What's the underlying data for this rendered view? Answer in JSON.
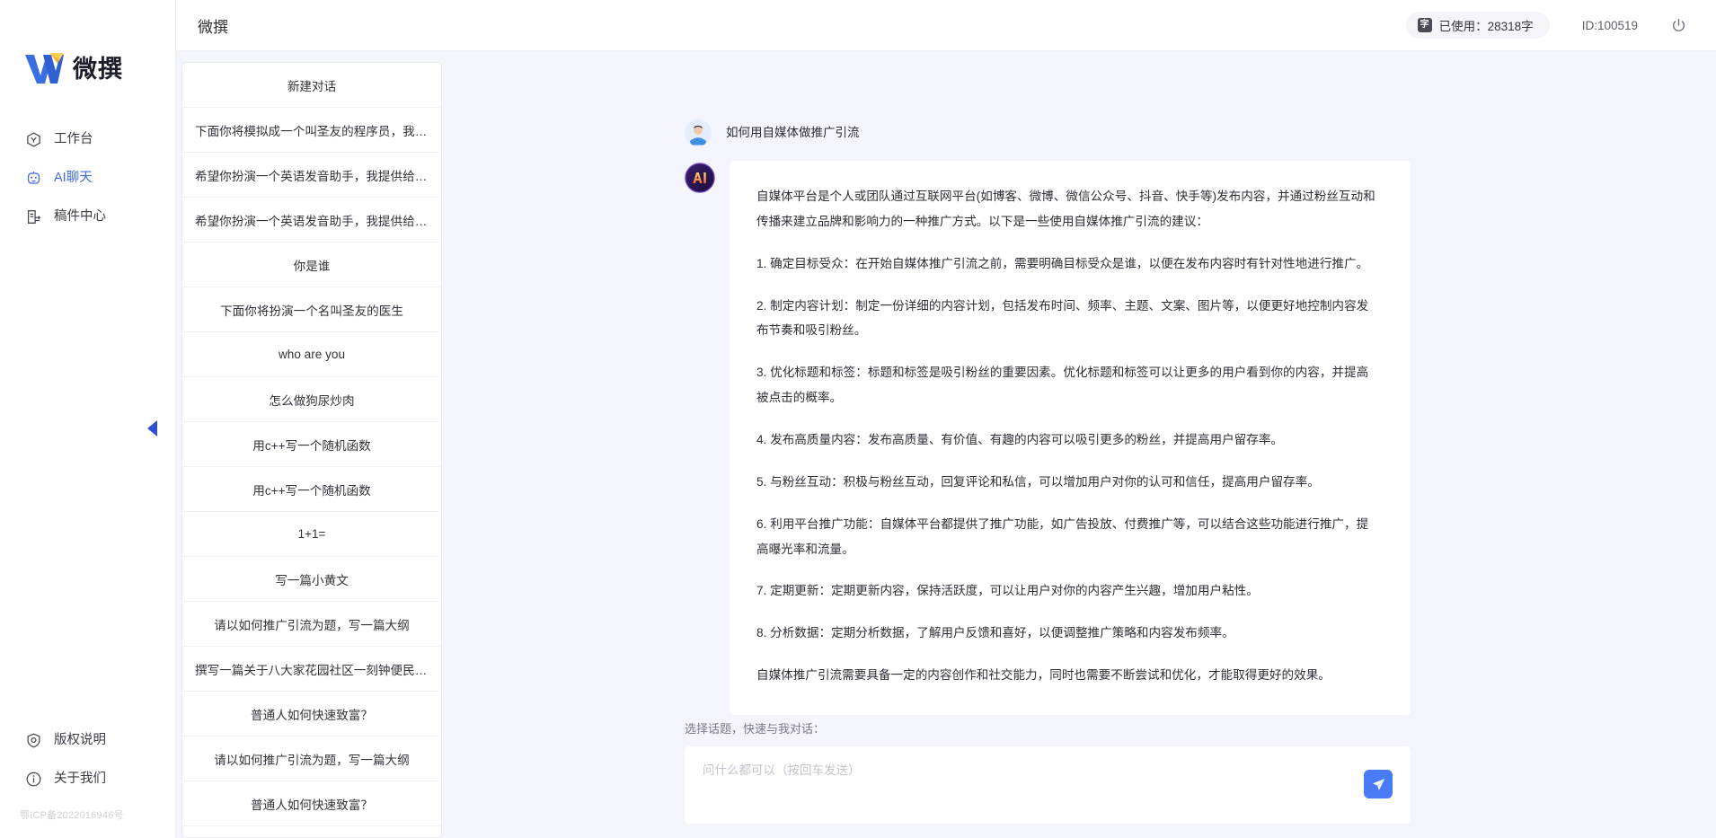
{
  "brand": {
    "name": "微撰",
    "logo_icon": "w-logo-icon"
  },
  "sidebar": {
    "items": [
      {
        "label": "工作台",
        "icon": "workbench-icon",
        "active": false
      },
      {
        "label": "AI聊天",
        "icon": "robot-icon",
        "active": true
      },
      {
        "label": "稿件中心",
        "icon": "document-edit-icon",
        "active": false
      }
    ],
    "bottom_items": [
      {
        "label": "版权说明",
        "icon": "shield-icon"
      },
      {
        "label": "关于我们",
        "icon": "info-icon"
      }
    ],
    "copyright": "鄂ICP备2022016946号",
    "collapse_icon": "chevron-left-icon"
  },
  "header": {
    "title": "微撰",
    "usage": {
      "badge": "字",
      "label": "已使用：28318字",
      "icon": "text-count-icon"
    },
    "user_id": "ID:100519",
    "power_icon": "power-icon"
  },
  "conversations": {
    "new_chat_label": "新建对话",
    "items": [
      "下面你将模拟成一个叫圣友的程序员，我说...",
      "希望你扮演一个英语发音助手，我提供给你...",
      "希望你扮演一个英语发音助手，我提供给你...",
      "你是谁",
      "下面你将扮演一个名叫圣友的医生",
      "who are you",
      "怎么做狗尿炒肉",
      "用c++写一个随机函数",
      "用c++写一个随机函数",
      "1+1=",
      "写一篇小黄文",
      "请以如何推广引流为题，写一篇大纲",
      "撰写一篇关于八大家花园社区一刻钟便民生...",
      "普通人如何快速致富？",
      "请以如何推广引流为题，写一篇大纲",
      "普通人如何快速致富？"
    ]
  },
  "chat": {
    "user_avatar_icon": "user-avatar-icon",
    "ai_avatar_icon": "ai-avatar-icon",
    "user_message": "如何用自媒体做推广引流",
    "ai_paragraphs": [
      "自媒体平台是个人或团队通过互联网平台(如博客、微博、微信公众号、抖音、快手等)发布内容，并通过粉丝互动和传播来建立品牌和影响力的一种推广方式。以下是一些使用自媒体推广引流的建议：",
      "1. 确定目标受众：在开始自媒体推广引流之前，需要明确目标受众是谁，以便在发布内容时有针对性地进行推广。",
      "2. 制定内容计划：制定一份详细的内容计划，包括发布时间、频率、主题、文案、图片等，以便更好地控制内容发布节奏和吸引粉丝。",
      "3. 优化标题和标签：标题和标签是吸引粉丝的重要因素。优化标题和标签可以让更多的用户看到你的内容，并提高被点击的概率。",
      "4. 发布高质量内容：发布高质量、有价值、有趣的内容可以吸引更多的粉丝，并提高用户留存率。",
      "5. 与粉丝互动：积极与粉丝互动，回复评论和私信，可以增加用户对你的认可和信任，提高用户留存率。",
      "6. 利用平台推广功能：自媒体平台都提供了推广功能，如广告投放、付费推广等，可以结合这些功能进行推广，提高曝光率和流量。",
      "7. 定期更新：定期更新内容，保持活跃度，可以让用户对你的内容产生兴趣，增加用户粘性。",
      "8. 分析数据：定期分析数据，了解用户反馈和喜好，以便调整推广策略和内容发布频率。",
      "自媒体推广引流需要具备一定的内容创作和社交能力，同时也需要不断尝试和优化，才能取得更好的效果。"
    ]
  },
  "composer": {
    "hint": "选择话题，快速与我对话：",
    "placeholder": "问什么都可以（按回车发送）",
    "value": "",
    "send_icon": "send-plane-icon"
  },
  "colors": {
    "accent": "#4169e8",
    "send_button": "#4a7bf7",
    "page_bg": "#f4f4fc",
    "panel_bg": "#ffffff"
  }
}
